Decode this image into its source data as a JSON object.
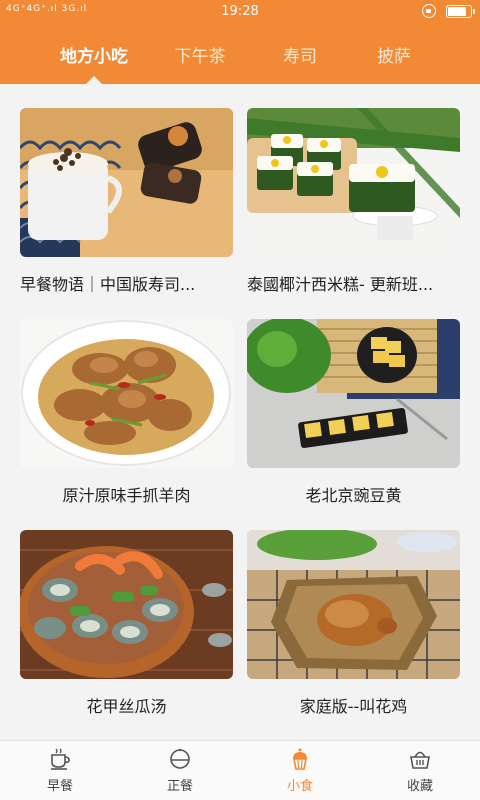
{
  "status_bar": {
    "signal_text": "4G⁺4G⁺.ıl 3G.ıl",
    "time": "19:28"
  },
  "tabs": [
    {
      "label": "地方小吃",
      "active": true
    },
    {
      "label": "下午茶",
      "active": false
    },
    {
      "label": "寿司",
      "active": false
    },
    {
      "label": "披萨",
      "active": false
    }
  ],
  "recipes": [
    {
      "title": "早餐物语｜中国版寿司...",
      "icon": "sushi-roll-coffee-photo"
    },
    {
      "title": "泰國椰汁西米糕- 更新班...",
      "icon": "coconut-sago-cake-photo"
    },
    {
      "title": "原汁原味手抓羊肉",
      "icon": "hand-pulled-lamb-photo"
    },
    {
      "title": "老北京豌豆黄",
      "icon": "pea-cake-photo"
    },
    {
      "title": "花甲丝瓜汤",
      "icon": "clam-luffa-soup-photo"
    },
    {
      "title": "家庭版--叫花鸡",
      "icon": "beggars-chicken-photo"
    }
  ],
  "bottom_nav": [
    {
      "label": "早餐",
      "icon": "coffee-cup-icon",
      "active": false
    },
    {
      "label": "正餐",
      "icon": "plate-dome-icon",
      "active": false
    },
    {
      "label": "小食",
      "icon": "cupcake-icon",
      "active": true
    },
    {
      "label": "收藏",
      "icon": "basket-icon",
      "active": false
    }
  ],
  "colors": {
    "accent": "#f28a35",
    "background": "#f3f3f3",
    "text": "#222222"
  }
}
